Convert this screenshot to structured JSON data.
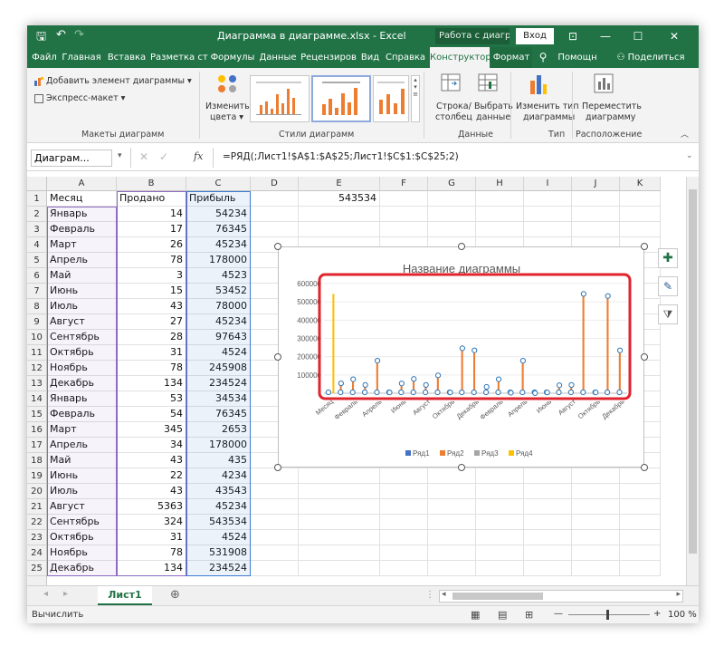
{
  "titlebar": {
    "title": "Диаграмма в диаграмме.xlsx - Excel",
    "context_label": "Работа с диагра...",
    "signin": "Вход",
    "qat_save": "🖫",
    "qat_undo": "↶",
    "qat_redo": "↷",
    "btn_ribbon": "⊡",
    "btn_min": "—",
    "btn_max": "☐",
    "btn_close": "✕"
  },
  "tabs": [
    {
      "label": "Файл"
    },
    {
      "label": "Главная"
    },
    {
      "label": "Вставка"
    },
    {
      "label": "Разметка стр"
    },
    {
      "label": "Формулы"
    },
    {
      "label": "Данные"
    },
    {
      "label": "Рецензиров"
    },
    {
      "label": "Вид"
    },
    {
      "label": "Справка"
    },
    {
      "label": "Конструктор"
    },
    {
      "label": "Формат"
    },
    {
      "label": "⚲"
    },
    {
      "label": "Помощн"
    },
    {
      "label": "⚇ Поделиться"
    }
  ],
  "ribbon": {
    "add_element": "Добавить элемент диаграммы ▾",
    "express_layout": "Экспресс-макет ▾",
    "group_layouts": "Макеты диаграмм",
    "change_colors_1": "Изменить",
    "change_colors_2": "цвета ▾",
    "group_styles": "Стили диаграмм",
    "row_col_1": "Строка/",
    "row_col_2": "столбец",
    "select_data_1": "Выбрать",
    "select_data_2": "данные",
    "group_data": "Данные",
    "change_type_1": "Изменить тип",
    "change_type_2": "диаграммы",
    "group_type": "Тип",
    "move_1": "Переместить",
    "move_2": "диаграмму",
    "group_location": "Расположение"
  },
  "formula_bar": {
    "name_box": "Диаграм...",
    "fx": "fx",
    "formula": "=РЯД(;Лист1!$A$1:$A$25;Лист1!$C$1:$C$25;2)"
  },
  "columns": [
    "A",
    "B",
    "C",
    "D",
    "E",
    "F",
    "G",
    "H",
    "I",
    "J",
    "K"
  ],
  "rows": [
    {
      "n": "1",
      "a": "Месяц",
      "b": "Продано",
      "c": "Прибыль"
    },
    {
      "n": "2",
      "a": "Январь",
      "b": "14",
      "c": "54234"
    },
    {
      "n": "3",
      "a": "Февраль",
      "b": "17",
      "c": "76345"
    },
    {
      "n": "4",
      "a": "Март",
      "b": "26",
      "c": "45234"
    },
    {
      "n": "5",
      "a": "Апрель",
      "b": "78",
      "c": "178000"
    },
    {
      "n": "6",
      "a": "Май",
      "b": "3",
      "c": "4523"
    },
    {
      "n": "7",
      "a": "Июнь",
      "b": "15",
      "c": "53452"
    },
    {
      "n": "8",
      "a": "Июль",
      "b": "43",
      "c": "78000"
    },
    {
      "n": "9",
      "a": "Август",
      "b": "27",
      "c": "45234"
    },
    {
      "n": "10",
      "a": "Сентябрь",
      "b": "28",
      "c": "97643"
    },
    {
      "n": "11",
      "a": "Октябрь",
      "b": "31",
      "c": "4524"
    },
    {
      "n": "12",
      "a": "Ноябрь",
      "b": "78",
      "c": "245908"
    },
    {
      "n": "13",
      "a": "Декабрь",
      "b": "134",
      "c": "234524"
    },
    {
      "n": "14",
      "a": "Январь",
      "b": "53",
      "c": "34534"
    },
    {
      "n": "15",
      "a": "Февраль",
      "b": "54",
      "c": "76345"
    },
    {
      "n": "16",
      "a": "Март",
      "b": "345",
      "c": "2653"
    },
    {
      "n": "17",
      "a": "Апрель",
      "b": "34",
      "c": "178000"
    },
    {
      "n": "18",
      "a": "Май",
      "b": "43",
      "c": "435"
    },
    {
      "n": "19",
      "a": "Июнь",
      "b": "22",
      "c": "4234"
    },
    {
      "n": "20",
      "a": "Июль",
      "b": "43",
      "c": "43543"
    },
    {
      "n": "21",
      "a": "Август",
      "b": "5363",
      "c": "45234"
    },
    {
      "n": "22",
      "a": "Сентябрь",
      "b": "324",
      "c": "543534"
    },
    {
      "n": "23",
      "a": "Октябрь",
      "b": "31",
      "c": "4524"
    },
    {
      "n": "24",
      "a": "Ноябрь",
      "b": "78",
      "c": "531908"
    },
    {
      "n": "25",
      "a": "Декабрь",
      "b": "134",
      "c": "234524"
    }
  ],
  "e1_value": "543534",
  "chart_data": {
    "type": "bar",
    "title": "Название диаграммы",
    "ylim": [
      0,
      600000
    ],
    "yticks": [
      "600000",
      "500000",
      "400000",
      "300000",
      "200000",
      "100000"
    ],
    "xticks": [
      "Месяц",
      "Февраль",
      "Апрель",
      "Июнь",
      "Август",
      "Октябрь",
      "Декабрь",
      "Февраль",
      "Апрель",
      "Июнь",
      "Август",
      "Октябрь",
      "Декабрь"
    ],
    "n_categories": 25,
    "series": [
      {
        "name": "Ряд1",
        "color": "#4472c4",
        "values": [
          0,
          0,
          0,
          0,
          0,
          0,
          0,
          0,
          0,
          0,
          0,
          0,
          0,
          0,
          0,
          0,
          0,
          0,
          0,
          0,
          0,
          0,
          0,
          0,
          0
        ]
      },
      {
        "name": "Ряд2",
        "color": "#ed7d31",
        "values": [
          0,
          54234,
          76345,
          45234,
          178000,
          4523,
          53452,
          78000,
          45234,
          97643,
          4524,
          245908,
          234524,
          34534,
          76345,
          2653,
          178000,
          435,
          4234,
          43543,
          45234,
          543534,
          4524,
          531908,
          234524
        ]
      },
      {
        "name": "Ряд3",
        "color": "#a5a5a5",
        "values": [
          0,
          0,
          0,
          0,
          0,
          0,
          0,
          0,
          0,
          0,
          0,
          0,
          0,
          0,
          0,
          0,
          0,
          0,
          0,
          0,
          0,
          0,
          0,
          0,
          0
        ]
      },
      {
        "name": "Ряд4",
        "color": "#ffc000",
        "values": [
          543534,
          0,
          0,
          0,
          0,
          0,
          0,
          0,
          0,
          0,
          0,
          0,
          0,
          0,
          0,
          0,
          0,
          0,
          0,
          0,
          0,
          0,
          0,
          0,
          0
        ]
      }
    ],
    "legend_position": "bottom",
    "highlight_color": "#e0242e"
  },
  "sheets": [
    {
      "label": "Лист1"
    }
  ],
  "add_sheet": "⊕",
  "status": {
    "mode": "Вычислить",
    "zoom": "100 %",
    "zoom_minus": "—",
    "zoom_plus": "+"
  }
}
